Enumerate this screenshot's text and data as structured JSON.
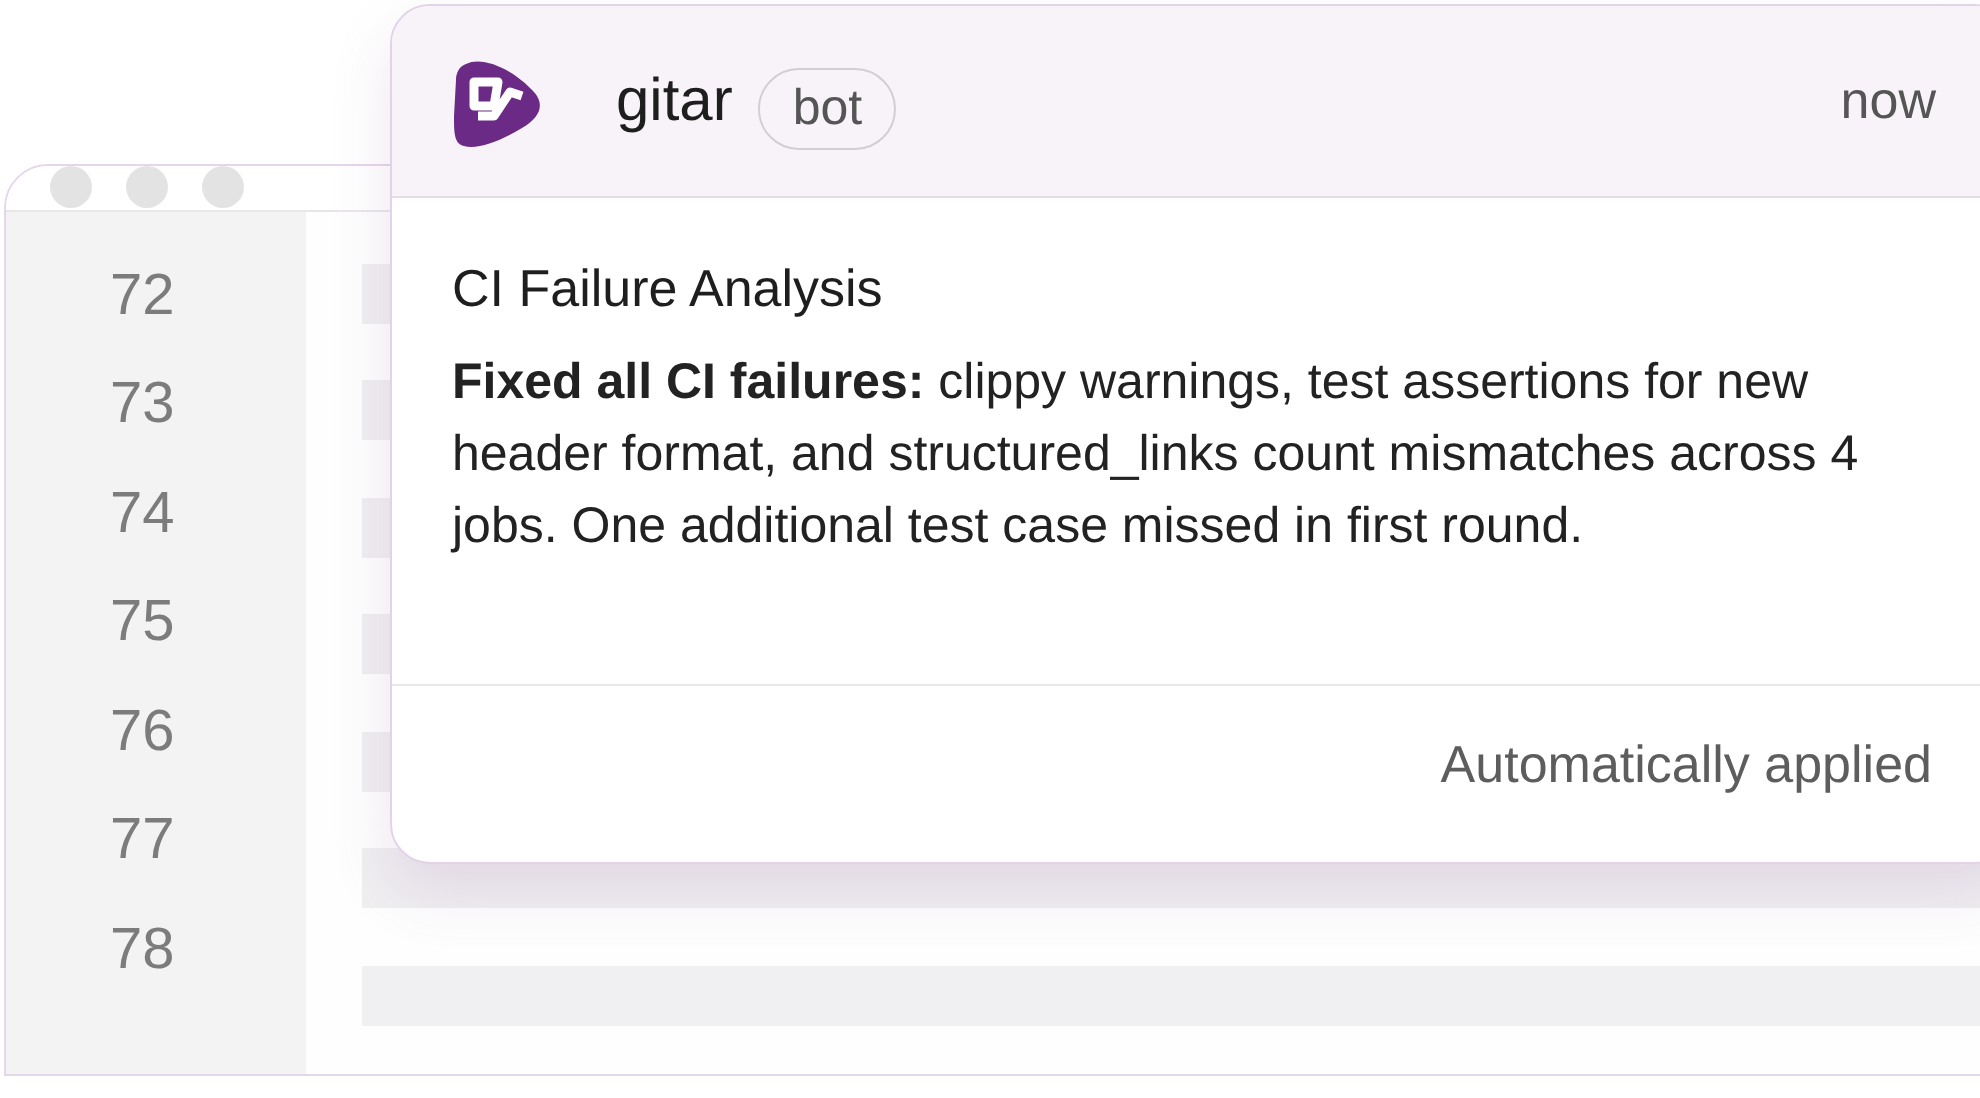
{
  "editor": {
    "line_numbers": [
      "72",
      "73",
      "74",
      "75",
      "76",
      "77",
      "78"
    ]
  },
  "notification": {
    "app_name": "gitar",
    "badge": "bot",
    "time": "now",
    "title": "CI Failure Analysis",
    "message": "**Fixed all CI failures:** clippy warnings, test assertions for new header format, and structured_links count mismatches across 4 jobs. One additional test case missed in first round.",
    "footer": "Automatically applied"
  }
}
